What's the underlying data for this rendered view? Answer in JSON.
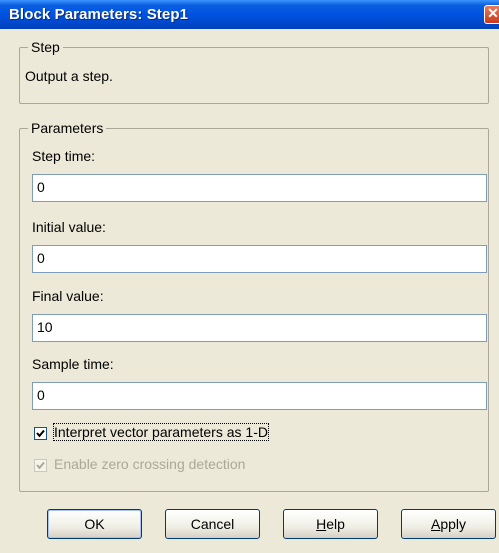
{
  "window": {
    "title": "Block Parameters: Step1",
    "close_glyph": "✕"
  },
  "step_group": {
    "legend": "Step",
    "description": "Output a step."
  },
  "parameters_group": {
    "legend": "Parameters",
    "fields": [
      {
        "label": "Step time:",
        "value": "0"
      },
      {
        "label": "Initial value:",
        "value": "0"
      },
      {
        "label": "Final value:",
        "value": "10"
      },
      {
        "label": "Sample time:",
        "value": "0"
      }
    ],
    "checkboxes": [
      {
        "label": "Interpret vector parameters as 1-D",
        "checked": true,
        "enabled": true
      },
      {
        "label": "Enable zero crossing detection",
        "checked": true,
        "enabled": false
      }
    ]
  },
  "buttons": {
    "ok": "OK",
    "cancel": "Cancel",
    "help_mnemonic": "H",
    "help_rest": "elp",
    "apply_mnemonic": "A",
    "apply_rest": "pply"
  },
  "icons": {
    "close": "close-icon",
    "check": "checkmark-icon"
  },
  "colors": {
    "titlebar": "#0053e0",
    "dialog_bg": "#ece9d8",
    "field_border": "#7f9db9"
  }
}
